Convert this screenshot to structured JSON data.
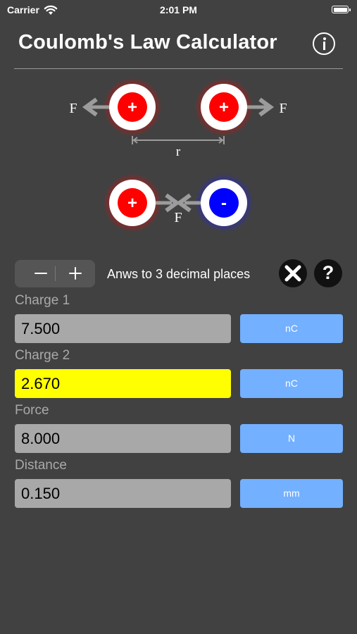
{
  "status_bar": {
    "carrier": "Carrier",
    "time": "2:01 PM"
  },
  "header": {
    "title": "Coulomb's Law Calculator"
  },
  "diagram": {
    "repel": {
      "force_label": "F",
      "charge_sign": "+",
      "distance_label": "r"
    },
    "attract": {
      "positive_sign": "+",
      "negative_sign": "-",
      "force_label": "F"
    }
  },
  "precision": {
    "label": "Anws to 3 decimal places",
    "decimal_places": 3
  },
  "fields": [
    {
      "label": "Charge 1",
      "value": "7.500",
      "unit": "nC"
    },
    {
      "label": "Charge 2",
      "value": "2.670",
      "unit": "nC"
    },
    {
      "label": "Force",
      "value": "8.000",
      "unit": "N"
    },
    {
      "label": "Distance",
      "value": "0.150",
      "unit": "mm"
    }
  ],
  "colors": {
    "background": "#414141",
    "active_field": "#ffff00",
    "unit_button": "#73b0ff",
    "positive_charge": "#ff0000",
    "negative_charge": "#0000ff"
  }
}
